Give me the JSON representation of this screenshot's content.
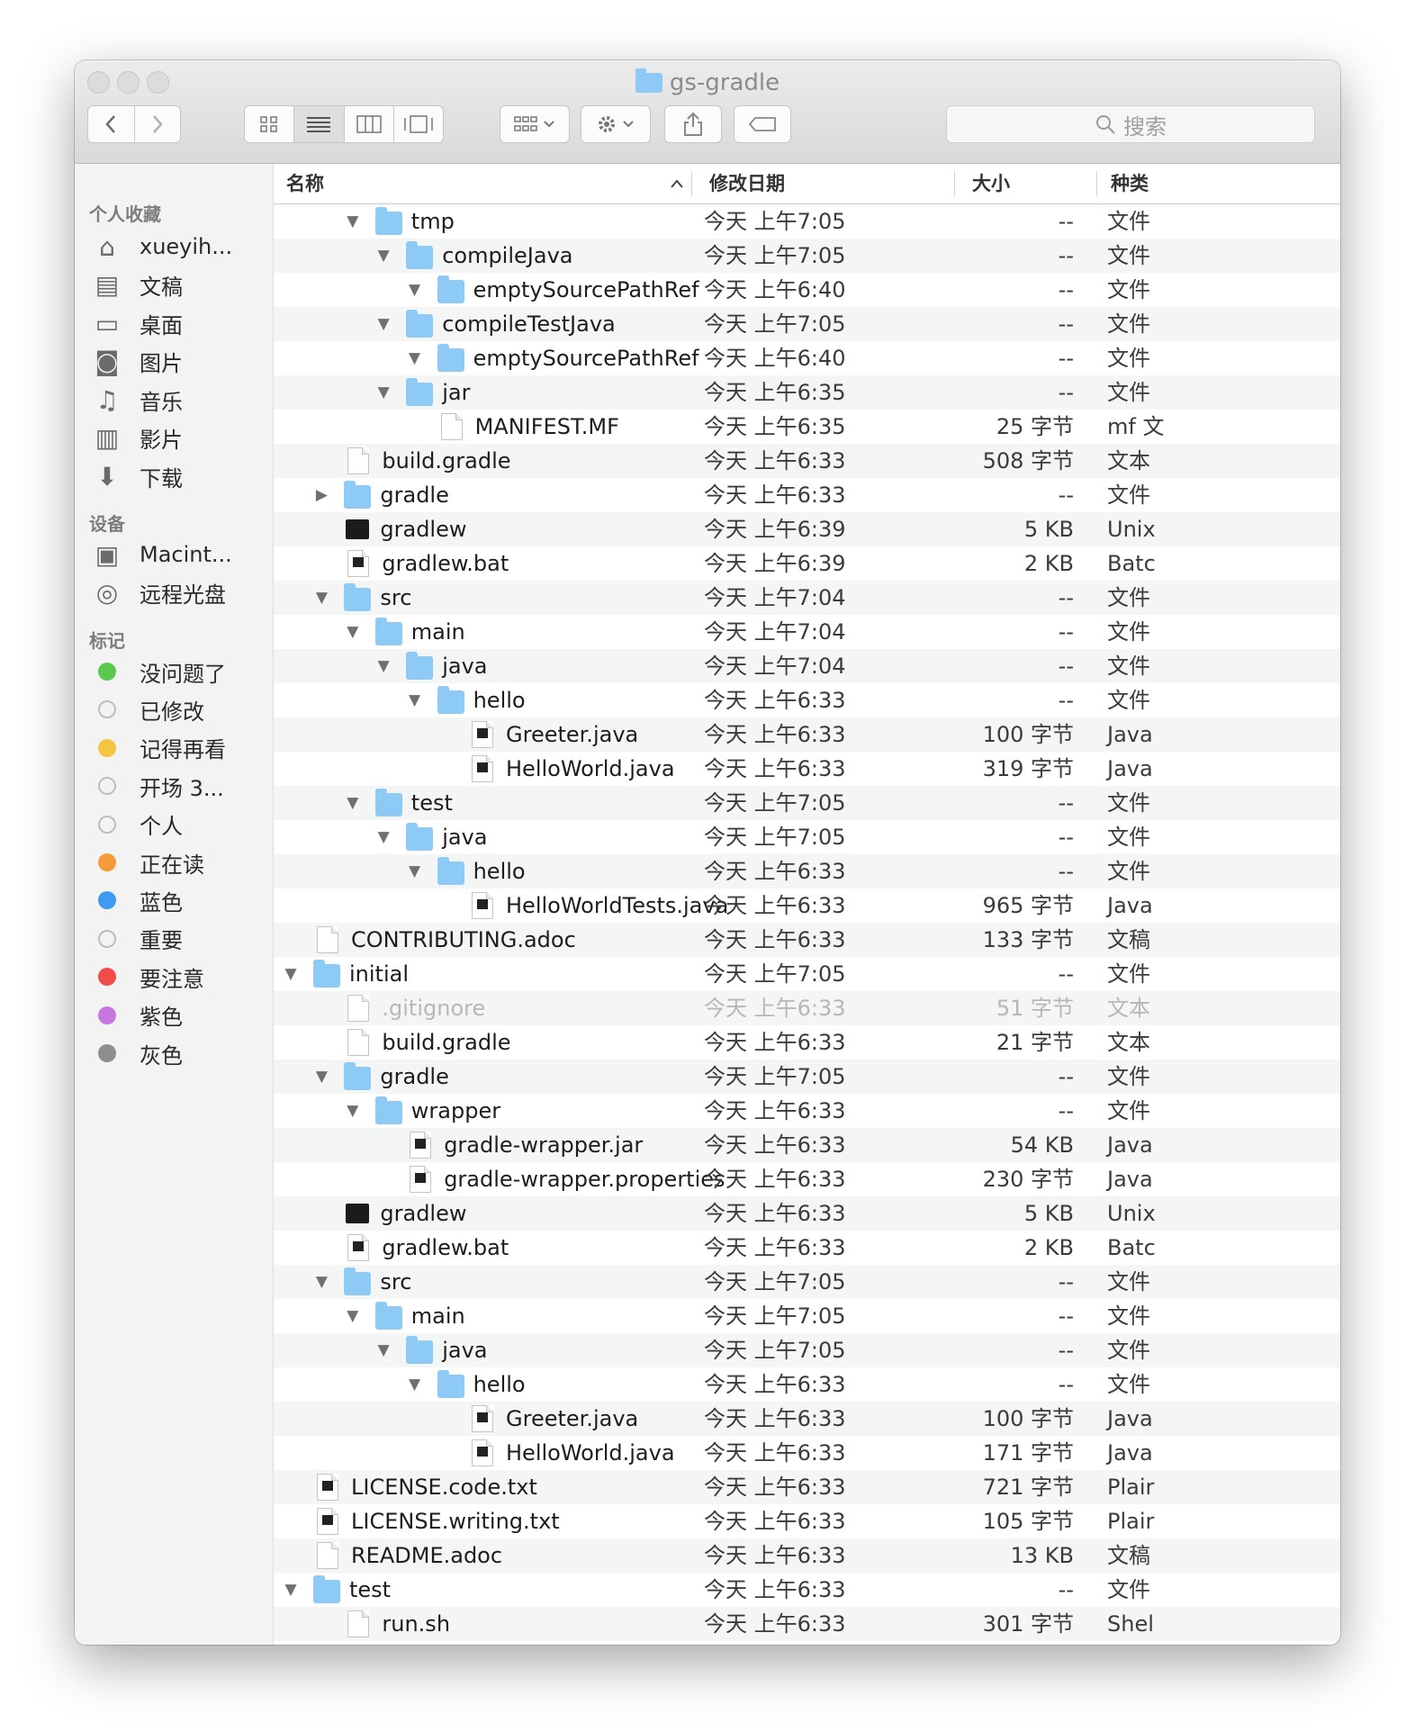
{
  "window": {
    "title": "gs-gradle"
  },
  "toolbar": {
    "back_icon": "chevron-left-icon",
    "forward_icon": "chevron-right-icon",
    "search_placeholder": "搜索"
  },
  "sidebar": {
    "favorites_header": "个人收藏",
    "favorites": [
      {
        "label": "xueyih...",
        "icon": "home-icon"
      },
      {
        "label": "文稿",
        "icon": "documents-icon"
      },
      {
        "label": "桌面",
        "icon": "desktop-icon"
      },
      {
        "label": "图片",
        "icon": "camera-icon"
      },
      {
        "label": "音乐",
        "icon": "music-icon"
      },
      {
        "label": "影片",
        "icon": "film-icon"
      },
      {
        "label": "下载",
        "icon": "download-icon"
      }
    ],
    "devices_header": "设备",
    "devices": [
      {
        "label": "Macint...",
        "icon": "hard-drive-icon"
      },
      {
        "label": "远程光盘",
        "icon": "disc-icon"
      }
    ],
    "tags_header": "标记",
    "tags": [
      {
        "label": "没问题了",
        "color": "#5ac84e"
      },
      {
        "label": "已修改",
        "color": ""
      },
      {
        "label": "记得再看",
        "color": "#f5c542"
      },
      {
        "label": "开场 3...",
        "color": ""
      },
      {
        "label": "个人",
        "color": ""
      },
      {
        "label": "正在读",
        "color": "#f59b3a"
      },
      {
        "label": "蓝色",
        "color": "#3f9bf2"
      },
      {
        "label": "重要",
        "color": ""
      },
      {
        "label": "要注意",
        "color": "#f14c47"
      },
      {
        "label": "紫色",
        "color": "#c678e0"
      },
      {
        "label": "灰色",
        "color": "#8e8e8e"
      }
    ]
  },
  "columns": {
    "name": "名称",
    "date": "修改日期",
    "size": "大小",
    "kind": "种类"
  },
  "rows": [
    {
      "name": "tmp",
      "depth": 3,
      "type": "folder",
      "toggle": "open",
      "date": "今天 上午7:05",
      "size": "--",
      "kind": "文件"
    },
    {
      "name": "compileJava",
      "depth": 4,
      "type": "folder",
      "toggle": "open",
      "date": "今天 上午7:05",
      "size": "--",
      "kind": "文件"
    },
    {
      "name": "emptySourcePathRef",
      "depth": 5,
      "type": "folder",
      "toggle": "open",
      "date": "今天 上午6:40",
      "size": "--",
      "kind": "文件"
    },
    {
      "name": "compileTestJava",
      "depth": 4,
      "type": "folder",
      "toggle": "open",
      "date": "今天 上午7:05",
      "size": "--",
      "kind": "文件"
    },
    {
      "name": "emptySourcePathRef",
      "depth": 5,
      "type": "folder",
      "toggle": "open",
      "date": "今天 上午6:40",
      "size": "--",
      "kind": "文件"
    },
    {
      "name": "jar",
      "depth": 4,
      "type": "folder",
      "toggle": "open",
      "date": "今天 上午6:35",
      "size": "--",
      "kind": "文件"
    },
    {
      "name": "MANIFEST.MF",
      "depth": 5,
      "type": "doc",
      "toggle": "",
      "date": "今天 上午6:35",
      "size": "25 字节",
      "kind": "mf 文"
    },
    {
      "name": "build.gradle",
      "depth": 2,
      "type": "doc",
      "toggle": "",
      "date": "今天 上午6:33",
      "size": "508 字节",
      "kind": "文本"
    },
    {
      "name": "gradle",
      "depth": 2,
      "type": "folder",
      "toggle": "closed",
      "date": "今天 上午6:33",
      "size": "--",
      "kind": "文件"
    },
    {
      "name": "gradlew",
      "depth": 2,
      "type": "term",
      "toggle": "",
      "date": "今天 上午6:39",
      "size": "5 KB",
      "kind": "Unix"
    },
    {
      "name": "gradlew.bat",
      "depth": 2,
      "type": "bin",
      "toggle": "",
      "date": "今天 上午6:39",
      "size": "2 KB",
      "kind": "Batc"
    },
    {
      "name": "src",
      "depth": 2,
      "type": "folder",
      "toggle": "open",
      "date": "今天 上午7:04",
      "size": "--",
      "kind": "文件"
    },
    {
      "name": "main",
      "depth": 3,
      "type": "folder",
      "toggle": "open",
      "date": "今天 上午7:04",
      "size": "--",
      "kind": "文件"
    },
    {
      "name": "java",
      "depth": 4,
      "type": "folder",
      "toggle": "open",
      "date": "今天 上午7:04",
      "size": "--",
      "kind": "文件"
    },
    {
      "name": "hello",
      "depth": 5,
      "type": "folder",
      "toggle": "open",
      "date": "今天 上午6:33",
      "size": "--",
      "kind": "文件"
    },
    {
      "name": "Greeter.java",
      "depth": 6,
      "type": "bin",
      "toggle": "",
      "date": "今天 上午6:33",
      "size": "100 字节",
      "kind": "Java"
    },
    {
      "name": "HelloWorld.java",
      "depth": 6,
      "type": "bin",
      "toggle": "",
      "date": "今天 上午6:33",
      "size": "319 字节",
      "kind": "Java"
    },
    {
      "name": "test",
      "depth": 3,
      "type": "folder",
      "toggle": "open",
      "date": "今天 上午7:05",
      "size": "--",
      "kind": "文件"
    },
    {
      "name": "java",
      "depth": 4,
      "type": "folder",
      "toggle": "open",
      "date": "今天 上午7:05",
      "size": "--",
      "kind": "文件"
    },
    {
      "name": "hello",
      "depth": 5,
      "type": "folder",
      "toggle": "open",
      "date": "今天 上午6:33",
      "size": "--",
      "kind": "文件"
    },
    {
      "name": "HelloWorldTests.java",
      "depth": 6,
      "type": "bin",
      "toggle": "",
      "date": "今天 上午6:33",
      "size": "965 字节",
      "kind": "Java"
    },
    {
      "name": "CONTRIBUTING.adoc",
      "depth": 1,
      "type": "doc",
      "toggle": "",
      "date": "今天 上午6:33",
      "size": "133 字节",
      "kind": "文稿"
    },
    {
      "name": "initial",
      "depth": 1,
      "type": "folder",
      "toggle": "open",
      "date": "今天 上午7:05",
      "size": "--",
      "kind": "文件"
    },
    {
      "name": ".gitignore",
      "depth": 2,
      "type": "doc",
      "toggle": "",
      "date": "今天 上午6:33",
      "size": "51 字节",
      "kind": "文本",
      "dim": true
    },
    {
      "name": "build.gradle",
      "depth": 2,
      "type": "doc",
      "toggle": "",
      "date": "今天 上午6:33",
      "size": "21 字节",
      "kind": "文本"
    },
    {
      "name": "gradle",
      "depth": 2,
      "type": "folder",
      "toggle": "open",
      "date": "今天 上午7:05",
      "size": "--",
      "kind": "文件"
    },
    {
      "name": "wrapper",
      "depth": 3,
      "type": "folder",
      "toggle": "open",
      "date": "今天 上午6:33",
      "size": "--",
      "kind": "文件"
    },
    {
      "name": "gradle-wrapper.jar",
      "depth": 4,
      "type": "bin",
      "toggle": "",
      "date": "今天 上午6:33",
      "size": "54 KB",
      "kind": "Java"
    },
    {
      "name": "gradle-wrapper.properties",
      "depth": 4,
      "type": "bin",
      "toggle": "",
      "date": "今天 上午6:33",
      "size": "230 字节",
      "kind": "Java"
    },
    {
      "name": "gradlew",
      "depth": 2,
      "type": "term",
      "toggle": "",
      "date": "今天 上午6:33",
      "size": "5 KB",
      "kind": "Unix"
    },
    {
      "name": "gradlew.bat",
      "depth": 2,
      "type": "bin",
      "toggle": "",
      "date": "今天 上午6:33",
      "size": "2 KB",
      "kind": "Batc"
    },
    {
      "name": "src",
      "depth": 2,
      "type": "folder",
      "toggle": "open",
      "date": "今天 上午7:05",
      "size": "--",
      "kind": "文件"
    },
    {
      "name": "main",
      "depth": 3,
      "type": "folder",
      "toggle": "open",
      "date": "今天 上午7:05",
      "size": "--",
      "kind": "文件"
    },
    {
      "name": "java",
      "depth": 4,
      "type": "folder",
      "toggle": "open",
      "date": "今天 上午7:05",
      "size": "--",
      "kind": "文件"
    },
    {
      "name": "hello",
      "depth": 5,
      "type": "folder",
      "toggle": "open",
      "date": "今天 上午6:33",
      "size": "--",
      "kind": "文件"
    },
    {
      "name": "Greeter.java",
      "depth": 6,
      "type": "bin",
      "toggle": "",
      "date": "今天 上午6:33",
      "size": "100 字节",
      "kind": "Java"
    },
    {
      "name": "HelloWorld.java",
      "depth": 6,
      "type": "bin",
      "toggle": "",
      "date": "今天 上午6:33",
      "size": "171 字节",
      "kind": "Java"
    },
    {
      "name": "LICENSE.code.txt",
      "depth": 1,
      "type": "bin",
      "toggle": "",
      "date": "今天 上午6:33",
      "size": "721 字节",
      "kind": "Plair"
    },
    {
      "name": "LICENSE.writing.txt",
      "depth": 1,
      "type": "bin",
      "toggle": "",
      "date": "今天 上午6:33",
      "size": "105 字节",
      "kind": "Plair"
    },
    {
      "name": "README.adoc",
      "depth": 1,
      "type": "doc",
      "toggle": "",
      "date": "今天 上午6:33",
      "size": "13 KB",
      "kind": "文稿"
    },
    {
      "name": "test",
      "depth": 1,
      "type": "folder",
      "toggle": "open",
      "date": "今天 上午6:33",
      "size": "--",
      "kind": "文件"
    },
    {
      "name": "run.sh",
      "depth": 2,
      "type": "doc",
      "toggle": "",
      "date": "今天 上午6:33",
      "size": "301 字节",
      "kind": "Shel"
    }
  ]
}
